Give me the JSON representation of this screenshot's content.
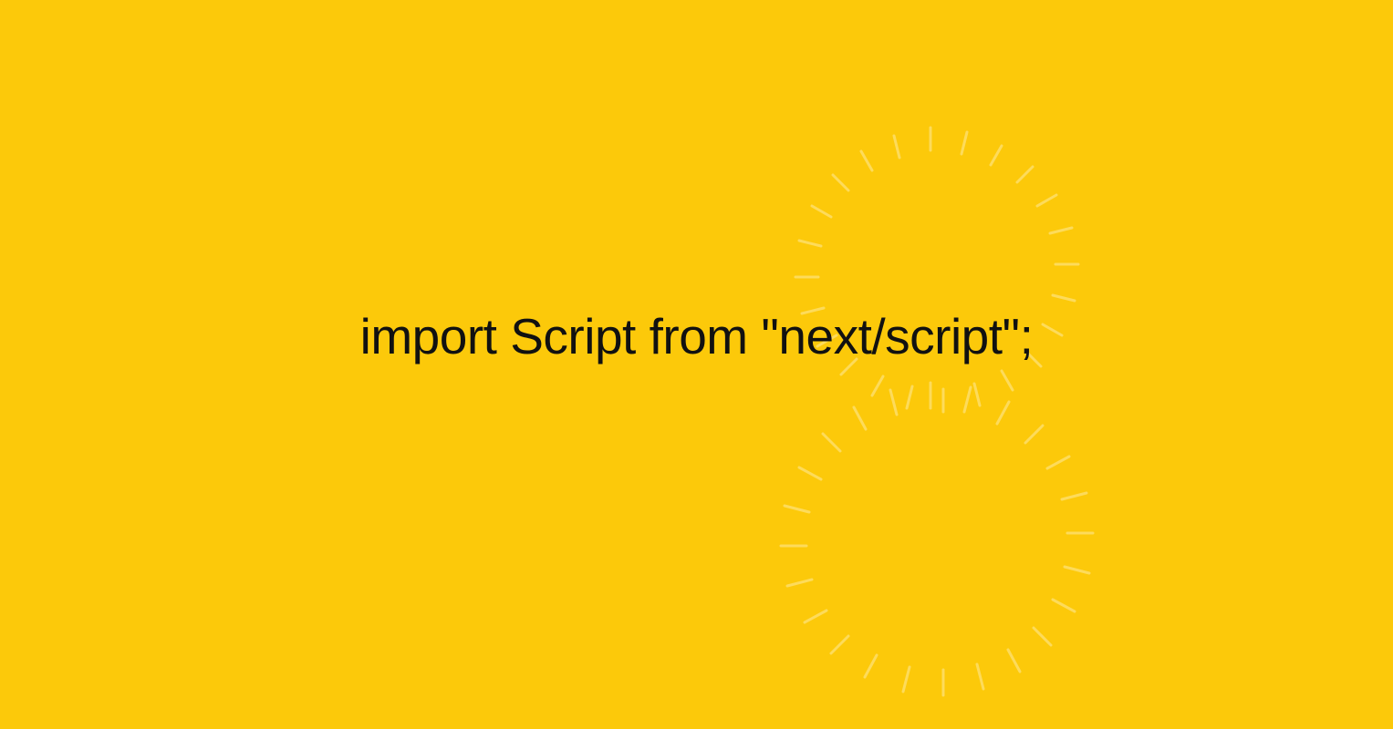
{
  "code": "import Script from \"next/script\";",
  "colors": {
    "background": "#fcc90a",
    "text": "#111111",
    "decoration": "#fee070"
  }
}
